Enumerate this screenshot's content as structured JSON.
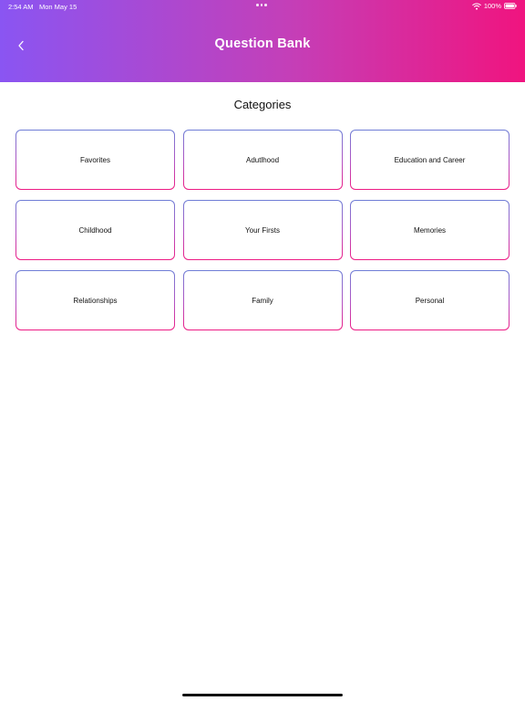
{
  "status_bar": {
    "time": "2:54 AM",
    "date": "Mon May 15",
    "battery": "100%"
  },
  "header": {
    "title": "Question Bank",
    "back_icon": "chevron-left-icon"
  },
  "categories": {
    "title": "Categories",
    "items": [
      {
        "label": "Favorites"
      },
      {
        "label": "Adutlhood"
      },
      {
        "label": "Education and Career"
      },
      {
        "label": "Childhood"
      },
      {
        "label": "Your Firsts"
      },
      {
        "label": "Memories"
      },
      {
        "label": "Relationships"
      },
      {
        "label": "Family"
      },
      {
        "label": "Personal"
      }
    ]
  },
  "colors": {
    "gradient_start": "#8a55f2",
    "gradient_end": "#f0147f"
  }
}
